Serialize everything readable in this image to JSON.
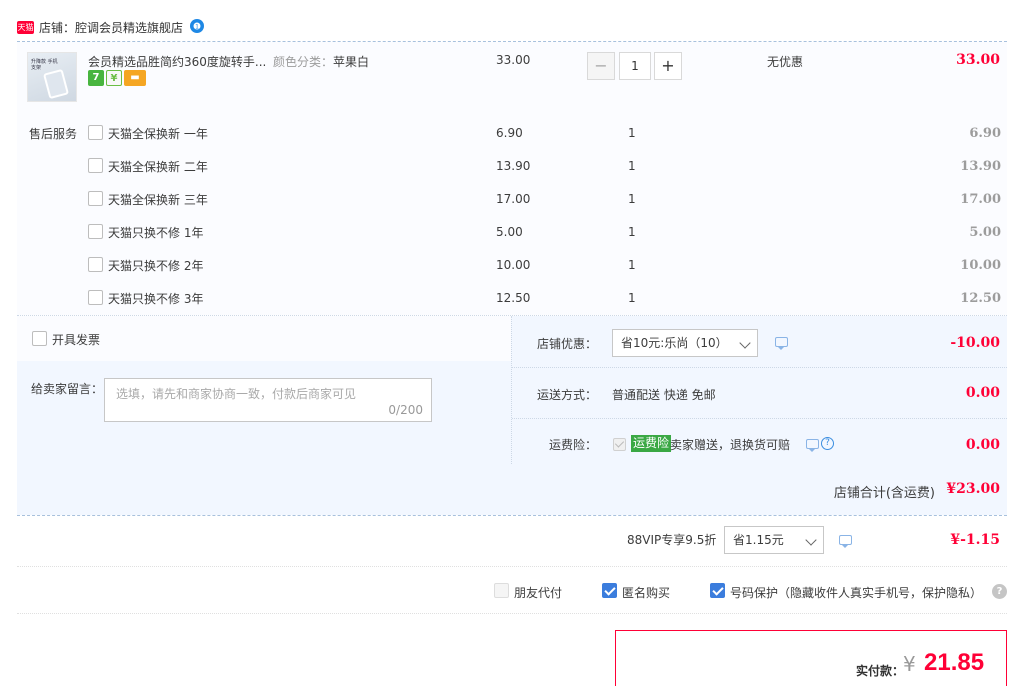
{
  "shop": {
    "badge": "天猫",
    "label": "店铺：腔调会员精选旗舰店",
    "ww_badge": "1"
  },
  "item": {
    "thumb_text": "升降款 手机支架",
    "title": "会员精选品胜简约360度旋转手...",
    "sku_label": "颜色分类：",
    "sku_value": "苹果白",
    "price": "33.00",
    "qty": "1",
    "qty_minus": "−",
    "qty_plus": "+",
    "discount": "无优惠",
    "total": "33.00",
    "promo_icons": [
      "seven-day-return-icon",
      "cashback-icon",
      "card-payment-icon"
    ]
  },
  "services": {
    "label": "售后服务",
    "rows": [
      {
        "name": "天猫全保换新 一年",
        "price": "6.90",
        "qty": "1",
        "total": "6.90"
      },
      {
        "name": "天猫全保换新 二年",
        "price": "13.90",
        "qty": "1",
        "total": "13.90"
      },
      {
        "name": "天猫全保换新 三年",
        "price": "17.00",
        "qty": "1",
        "total": "17.00"
      },
      {
        "name": "天猫只换不修 1年",
        "price": "5.00",
        "qty": "1",
        "total": "5.00"
      },
      {
        "name": "天猫只换不修 2年",
        "price": "10.00",
        "qty": "1",
        "total": "10.00"
      },
      {
        "name": "天猫只换不修 3年",
        "price": "12.50",
        "qty": "1",
        "total": "12.50"
      }
    ]
  },
  "invoice": {
    "label": "开具发票"
  },
  "message": {
    "label": "给卖家留言：",
    "placeholder": "选填，请先和商家协商一致，付款后商家可见",
    "count": "0/200"
  },
  "coupon": {
    "label": "店铺优惠：",
    "selected": "省10元:乐尚（10）",
    "value": "-10.00"
  },
  "shipping": {
    "label": "运送方式：",
    "method": "普通配送 快递 免邮",
    "value": "0.00"
  },
  "insurance": {
    "label": "运费险：",
    "tag": "运费险",
    "text": "卖家赠送，退换货可赔",
    "value": "0.00"
  },
  "shop_total": {
    "label": "店铺合计(含运费)",
    "value": "¥23.00"
  },
  "vip": {
    "label": "88VIP专享9.5折",
    "selected": "省1.15元",
    "value": "¥-1.15"
  },
  "options": {
    "friend_pay": "朋友代付",
    "anonymous": "匿名购买",
    "privacy": "号码保护（隐藏收件人真实手机号，保护隐私）",
    "help": "?"
  },
  "payment": {
    "label": "实付款：",
    "currency": "¥",
    "amount": "21.85"
  },
  "colors": {
    "accent_red": "#ff0036",
    "panel_blue": "#f2f7ff",
    "checkbox_blue": "#3b7ddd"
  }
}
